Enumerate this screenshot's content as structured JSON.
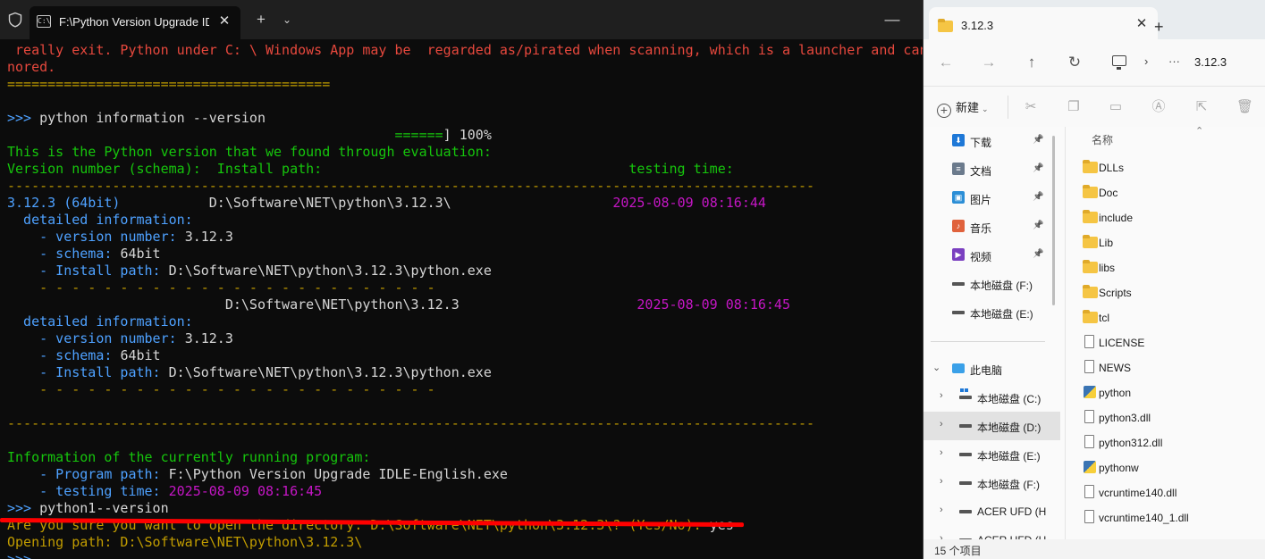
{
  "terminal": {
    "tab_title": "F:\\Python Version Upgrade IDL",
    "tab_icon": "C:\\",
    "lines": [
      [
        {
          "t": " really exit. Python under C: \\ Windows App may be  regarded as/pirated when scanning, which is a launcher and can be ig",
          "c": "r"
        }
      ],
      [
        {
          "t": "nored.",
          "c": "r"
        }
      ],
      [
        {
          "t": "========================================",
          "c": "y"
        }
      ],
      [
        {
          "t": "",
          "c": "w"
        }
      ],
      [
        {
          "t": ">>> ",
          "c": "b"
        },
        {
          "t": "python information --version",
          "c": "w"
        }
      ],
      [
        {
          "t": "                                                ======",
          "c": "g"
        },
        {
          "t": "] 100%",
          "c": "w"
        }
      ],
      [
        {
          "t": "This is the Python version that we found through evaluation:",
          "c": "g"
        }
      ],
      [
        {
          "t": "Version number (schema):  Install path:                                      testing time:",
          "c": "g"
        }
      ],
      [
        {
          "t": "----------------------------------------------------------------------------------------------------",
          "c": "y"
        }
      ],
      [
        {
          "t": "3.12.3 (64bit)",
          "c": "b"
        },
        {
          "t": "           D:\\Software\\NET\\python\\3.12.3\\                    ",
          "c": "w"
        },
        {
          "t": "2025-08-09 08:16:44",
          "c": "m"
        }
      ],
      [
        {
          "t": "  detailed information:",
          "c": "b"
        }
      ],
      [
        {
          "t": "    - version number: ",
          "c": "b"
        },
        {
          "t": "3.12.3",
          "c": "w"
        }
      ],
      [
        {
          "t": "    - schema: ",
          "c": "b"
        },
        {
          "t": "64bit",
          "c": "w"
        }
      ],
      [
        {
          "t": "    - Install path: ",
          "c": "b"
        },
        {
          "t": "D:\\Software\\NET\\python\\3.12.3\\python.exe",
          "c": "w"
        }
      ],
      [
        {
          "t": "    - - - - - - - - - - - - - - - - - - - - - - - - -",
          "c": "y"
        }
      ],
      [
        {
          "t": "                           D:\\Software\\NET\\python\\3.12.3                      ",
          "c": "w"
        },
        {
          "t": "2025-08-09 08:16:45",
          "c": "m"
        }
      ],
      [
        {
          "t": "  detailed information:",
          "c": "b"
        }
      ],
      [
        {
          "t": "    - version number: ",
          "c": "b"
        },
        {
          "t": "3.12.3",
          "c": "w"
        }
      ],
      [
        {
          "t": "    - schema: ",
          "c": "b"
        },
        {
          "t": "64bit",
          "c": "w"
        }
      ],
      [
        {
          "t": "    - Install path: ",
          "c": "b"
        },
        {
          "t": "D:\\Software\\NET\\python\\3.12.3\\python.exe",
          "c": "w"
        }
      ],
      [
        {
          "t": "    - - - - - - - - - - - - - - - - - - - - - - - - -",
          "c": "y"
        }
      ],
      [
        {
          "t": "",
          "c": "w"
        }
      ],
      [
        {
          "t": "----------------------------------------------------------------------------------------------------",
          "c": "y"
        }
      ],
      [
        {
          "t": "",
          "c": "w"
        }
      ],
      [
        {
          "t": "Information of the currently running program:",
          "c": "g"
        }
      ],
      [
        {
          "t": "    - Program path: ",
          "c": "b"
        },
        {
          "t": "F:\\Python Version Upgrade IDLE-English.exe",
          "c": "w"
        }
      ],
      [
        {
          "t": "    - testing time: ",
          "c": "b"
        },
        {
          "t": "2025-08-09 08:16:45",
          "c": "m"
        }
      ],
      [
        {
          "t": ">>> ",
          "c": "b"
        },
        {
          "t": "python1--version",
          "c": "w"
        }
      ],
      [
        {
          "t": "Are you sure you want to open the directory: D:\\Software\\NET\\python\\3.12.3\\? (Yes/No): ",
          "c": "y"
        },
        {
          "t": "yes",
          "c": "w"
        }
      ],
      [
        {
          "t": "Opening path: D:\\Software\\NET\\python\\3.12.3\\",
          "c": "y"
        }
      ],
      [
        {
          "t": ">>>",
          "c": "b"
        }
      ]
    ]
  },
  "explorer": {
    "tab_title": "3.12.3",
    "address_path": "3.12.3",
    "address_more": "···",
    "new_label": "新建",
    "column_name": "名称",
    "status": "15 个项目",
    "nav_items": [
      {
        "label": "下载",
        "icon": "download-icon",
        "color": "#1e78d7",
        "pinned": true
      },
      {
        "label": "文档",
        "icon": "document-icon",
        "color": "#6b7a8c",
        "pinned": true
      },
      {
        "label": "图片",
        "icon": "pictures-icon",
        "color": "#2b8ed6",
        "pinned": true
      },
      {
        "label": "音乐",
        "icon": "music-icon",
        "color": "#e0623c",
        "pinned": true
      },
      {
        "label": "视频",
        "icon": "video-icon",
        "color": "#7a3fc0",
        "pinned": true
      },
      {
        "label": "本地磁盘 (F:)",
        "icon": "drive-icon",
        "color": "#555555",
        "pinned": false
      },
      {
        "label": "本地磁盘 (E:)",
        "icon": "drive-icon",
        "color": "#555555",
        "pinned": false
      }
    ],
    "tree_items": [
      {
        "label": "此电脑",
        "icon": "pc-icon",
        "expanded": true,
        "selected": false
      },
      {
        "label": "本地磁盘 (C:)",
        "icon": "windows-drive-icon",
        "expanded": false,
        "selected": false
      },
      {
        "label": "本地磁盘 (D:)",
        "icon": "drive-icon",
        "expanded": false,
        "selected": true
      },
      {
        "label": "本地磁盘 (E:)",
        "icon": "drive-icon",
        "expanded": false,
        "selected": false
      },
      {
        "label": "本地磁盘 (F:)",
        "icon": "drive-icon",
        "expanded": false,
        "selected": false
      },
      {
        "label": "ACER UFD (H",
        "icon": "usb-icon",
        "expanded": false,
        "selected": false
      },
      {
        "label": "ACER UFD (H",
        "icon": "usb-icon",
        "expanded": false,
        "selected": false
      }
    ],
    "files": [
      {
        "name": "DLLs",
        "type": "folder"
      },
      {
        "name": "Doc",
        "type": "folder"
      },
      {
        "name": "include",
        "type": "folder"
      },
      {
        "name": "Lib",
        "type": "folder"
      },
      {
        "name": "libs",
        "type": "folder"
      },
      {
        "name": "Scripts",
        "type": "folder"
      },
      {
        "name": "tcl",
        "type": "folder"
      },
      {
        "name": "LICENSE",
        "type": "file"
      },
      {
        "name": "NEWS",
        "type": "file"
      },
      {
        "name": "python",
        "type": "python"
      },
      {
        "name": "python3.dll",
        "type": "file"
      },
      {
        "name": "python312.dll",
        "type": "file"
      },
      {
        "name": "pythonw",
        "type": "python"
      },
      {
        "name": "vcruntime140.dll",
        "type": "file"
      },
      {
        "name": "vcruntime140_1.dll",
        "type": "file"
      }
    ]
  }
}
